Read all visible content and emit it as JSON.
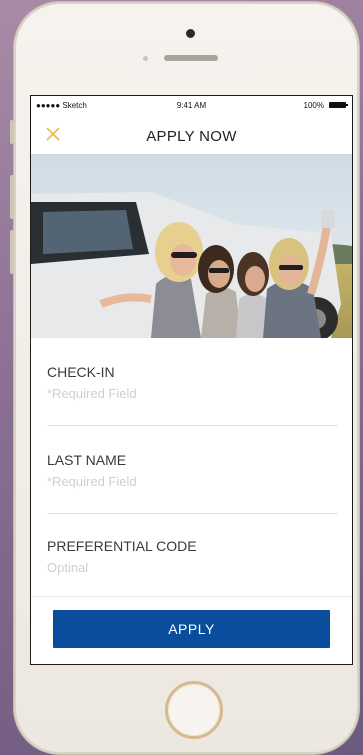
{
  "status_bar": {
    "carrier": "●●●●● Sketch",
    "time": "9:41 AM",
    "battery": "100%"
  },
  "header": {
    "title": "APPLY NOW",
    "close_icon": "close-icon"
  },
  "form": {
    "fields": [
      {
        "label": "CHECK-IN",
        "placeholder": "*Required Field"
      },
      {
        "label": "LAST NAME",
        "placeholder": "*Required Field"
      },
      {
        "label": "PREFERENTIAL CODE",
        "placeholder": "Optinal"
      }
    ]
  },
  "footer": {
    "apply_label": "APPLY"
  },
  "colors": {
    "accent": "#e8b84a",
    "primary_button": "#0a4d9c"
  }
}
